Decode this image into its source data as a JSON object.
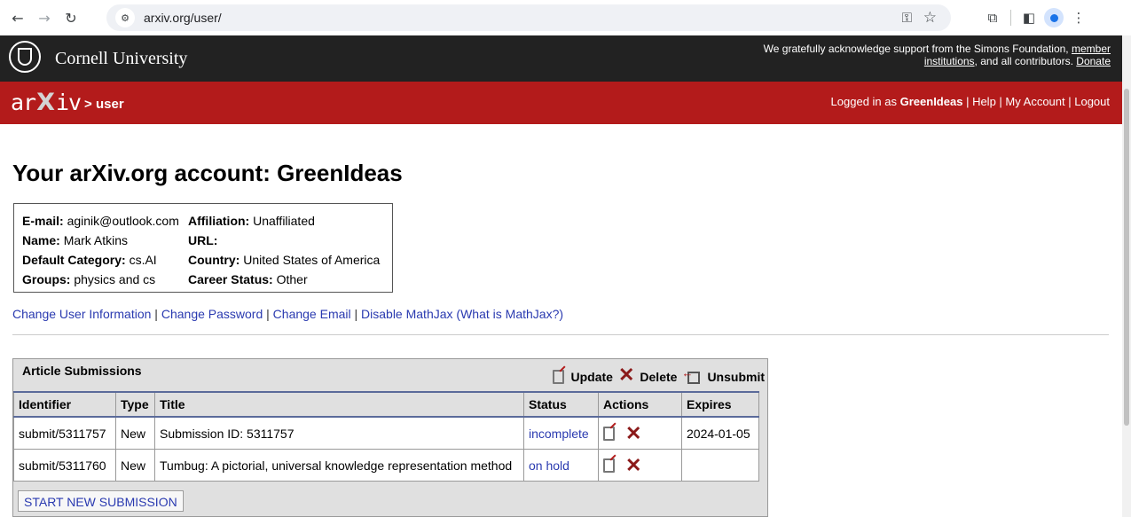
{
  "browser": {
    "url": "arxiv.org/user/"
  },
  "cornell": {
    "name": "Cornell University",
    "support_text": "We gratefully acknowledge support from the Simons Foundation,",
    "support_link1": "member institutions",
    "support_mid": ", and all contributors.",
    "support_link2": "Donate"
  },
  "arxiv_bar": {
    "logo_left": "ar",
    "logo_x": "X",
    "logo_right": "iv",
    "crumb": "> user",
    "logged_in_prefix": "Logged in as",
    "username": "GreenIdeas",
    "help": "Help",
    "my_account": "My Account",
    "logout": "Logout"
  },
  "page": {
    "title": "Your arXiv.org account: GreenIdeas"
  },
  "account": {
    "email_label": "E-mail:",
    "email": "aginik@outlook.com",
    "name_label": "Name:",
    "name": "Mark Atkins",
    "category_label": "Default Category:",
    "category": "cs.AI",
    "groups_label": "Groups:",
    "groups": "physics and cs",
    "affiliation_label": "Affiliation:",
    "affiliation": "Unaffiliated",
    "url_label": "URL:",
    "url": "",
    "country_label": "Country:",
    "country": "United States of America",
    "career_label": "Career Status:",
    "career": "Other"
  },
  "links": {
    "change_info": "Change User Information",
    "change_password": "Change Password",
    "change_email": "Change Email",
    "disable_mathjax": "Disable MathJax",
    "what_is_mathjax": "What is MathJax?"
  },
  "submissions": {
    "heading": "Article Submissions",
    "legend_update": "Update",
    "legend_delete": "Delete",
    "legend_unsubmit": "Unsubmit",
    "columns": [
      "Identifier",
      "Type",
      "Title",
      "Status",
      "Actions",
      "Expires"
    ],
    "rows": [
      {
        "identifier": "submit/5311757",
        "type": "New",
        "title": "Submission ID: 5311757",
        "status": "incomplete",
        "expires": "2024-01-05"
      },
      {
        "identifier": "submit/5311760",
        "type": "New",
        "title": "Tumbug: A pictorial, universal knowledge representation method",
        "status": "on hold",
        "expires": ""
      }
    ],
    "start_button": "START NEW SUBMISSION"
  }
}
